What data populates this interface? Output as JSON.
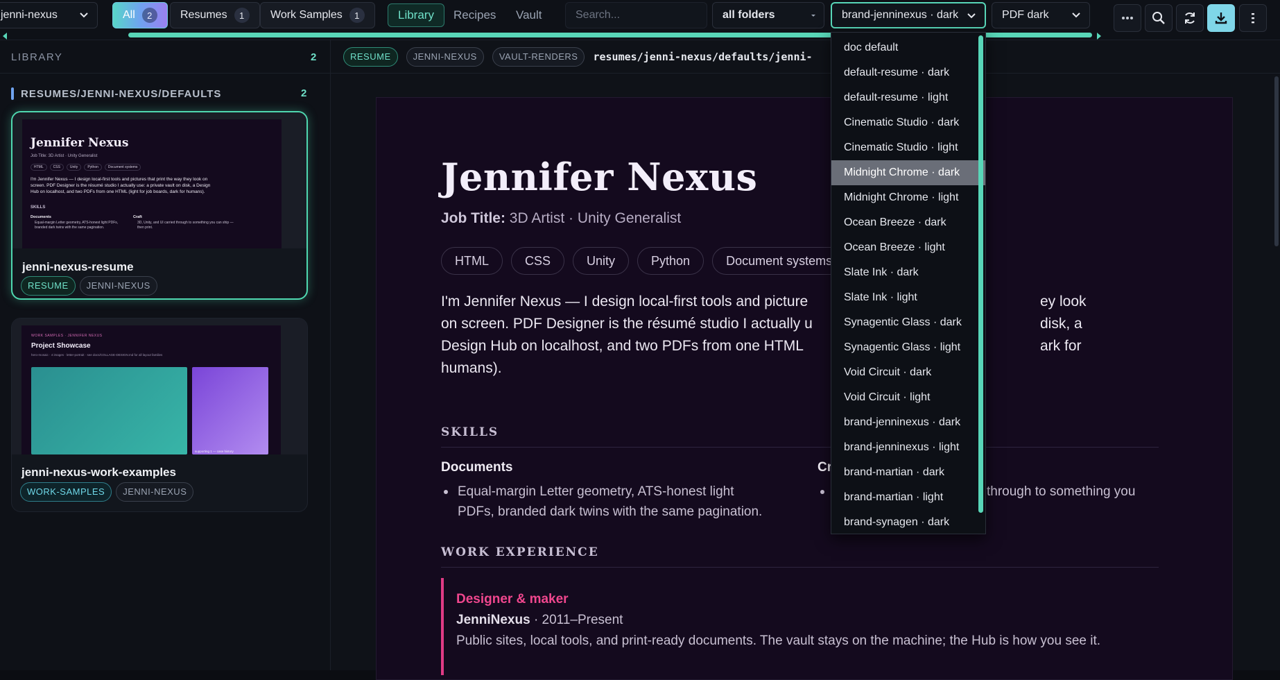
{
  "topbar": {
    "project_select": "jenni-nexus",
    "filters": [
      {
        "label": "All",
        "count": "2"
      },
      {
        "label": "Resumes",
        "count": "1"
      },
      {
        "label": "Work Samples",
        "count": "1"
      }
    ],
    "tabs": [
      "Library",
      "Recipes",
      "Vault"
    ],
    "search_placeholder": "Search...",
    "folder_select": "all folders",
    "theme_select": "brand-jenninexus · dark",
    "pdf_select": "PDF dark",
    "icons": [
      "more-icon",
      "search-icon",
      "refresh-icon",
      "download-icon",
      "menu-icon"
    ],
    "accent_color": "#58d6b8"
  },
  "sidebar": {
    "heading": "LIBRARY",
    "count": "2",
    "folder": {
      "label": "RESUMES/JENNI-NEXUS/DEFAULTS",
      "count": "2"
    },
    "cards": [
      {
        "title": "jenni-nexus-resume",
        "tags": [
          "RESUME",
          "JENNI-NEXUS"
        ],
        "thumb": {
          "name": "Jennifer Nexus",
          "job": "Job Title: 3D Artist · Unity Generalist",
          "skills": [
            "HTML",
            "CSS",
            "Unity",
            "Python",
            "Document systems"
          ],
          "bio": "I'm Jennifer Nexus — I design local-first tools and pictures that print the way they look on screen. PDF Designer is the résumé studio I actually use: a private vault on disk, a Design Hub on localhost, and two PDFs from one HTML (light for job boards, dark for humans).",
          "section": "SKILLS",
          "col1_head": "Documents",
          "col1_text": "Equal-margin Letter geometry, ATS-honest light PDFs, branded dark twins with the same pagination.",
          "col2_head": "Craft",
          "col2_text": "3D, Unity, and UI carried through to something you can ship — then print."
        }
      },
      {
        "title": "jenni-nexus-work-examples",
        "tags": [
          "WORK-SAMPLES",
          "JENNI-NEXUS"
        ],
        "thumb": {
          "kicker": "WORK SAMPLES · JENNIFER NEXUS",
          "title": "Project Showcase",
          "sub": "hero-mosaic · 4 images · letter-portrait · see docs/COLLAGE-DESIGN.md for all layout families",
          "caption": "supporting 1 — case history"
        }
      }
    ]
  },
  "main": {
    "badges": [
      "RESUME",
      "JENNI-NEXUS",
      "VAULT-RENDERS"
    ],
    "path": "resumes/jenni-nexus/defaults/jenni-",
    "doc": {
      "name": "Jennifer Nexus",
      "job_label": "Job Title:",
      "job_value": "3D Artist · Unity Generalist",
      "skills": [
        "HTML",
        "CSS",
        "Unity",
        "Python",
        "Document systems"
      ],
      "bio_lines": [
        "I'm Jennifer Nexus — I design local-first tools and picture",
        "on screen. PDF Designer is the résumé studio I actually u",
        "Design Hub on localhost, and two PDFs from one HTML",
        "humans)."
      ],
      "bio_tails": [
        "ey look",
        "disk, a",
        "ark for"
      ],
      "skills_heading": "SKILLS",
      "col1_head": "Documents",
      "col1_lines": [
        "Equal-margin Letter geometry, ATS-honest light",
        "PDFs, branded dark twins with the same pagination."
      ],
      "col2_head": "Cr",
      "col2_tail": "through to something you",
      "work_heading": "WORK EXPERIENCE",
      "exp_role": "Designer & maker",
      "exp_company": "JenniNexus",
      "exp_years": "· 2011–Present",
      "exp_desc": "Public sites, local tools, and print-ready documents. The vault stays on the machine; the Hub is how you see it."
    }
  },
  "theme_dropdown": {
    "options": [
      "doc default",
      "default-resume · dark",
      "default-resume · light",
      "Cinematic Studio · dark",
      "Cinematic Studio · light",
      "Midnight Chrome · dark",
      "Midnight Chrome · light",
      "Ocean Breeze · dark",
      "Ocean Breeze · light",
      "Slate Ink · dark",
      "Slate Ink · light",
      "Synagentic Glass · dark",
      "Synagentic Glass · light",
      "Void Circuit · dark",
      "Void Circuit · light",
      "brand-jenninexus · dark",
      "brand-jenninexus · light",
      "brand-martian · dark",
      "brand-martian · light",
      "brand-synagen · dark"
    ],
    "highlighted_index": 5
  }
}
